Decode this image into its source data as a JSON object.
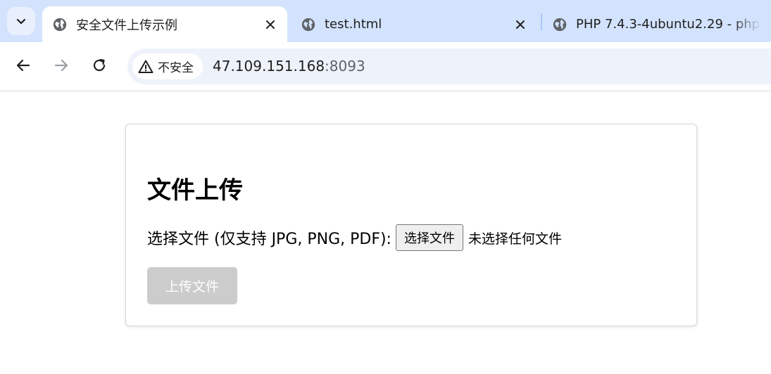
{
  "browser": {
    "tabs": [
      {
        "title": "安全文件上传示例",
        "active": true
      },
      {
        "title": "test.html",
        "active": false
      },
      {
        "title": "PHP 7.4.3-4ubuntu2.29 - php",
        "active": false
      }
    ],
    "security_chip": "不安全",
    "url_host": "47.109.151.168",
    "url_port": ":8093",
    "colors": {
      "tabstrip": "#d3e3fd",
      "omnibox": "#eef2fa"
    }
  },
  "page": {
    "heading": "文件上传",
    "file_label": "选择文件 (仅支持 JPG, PNG, PDF):",
    "file_button": "选择文件",
    "no_file_text": "未选择任何文件",
    "upload_button": "上传文件",
    "colors": {
      "upload_disabled_bg": "#cccccc"
    }
  }
}
